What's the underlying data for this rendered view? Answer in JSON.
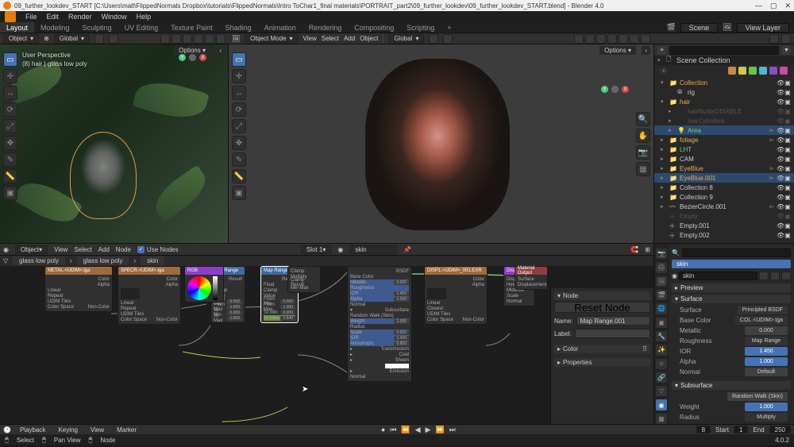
{
  "titlebar": {
    "text": "09_further_lookdev_START [C:\\Users\\malt\\FlippedNormals Dropbox\\tutorials\\FlippedNormals\\Intro ToChar1_final materials\\PORTRAIT_part2\\09_further_lookdev\\09_further_lookdev_START.blend] - Blender 4.0"
  },
  "menubar": {
    "items": [
      "File",
      "Edit",
      "Render",
      "Window",
      "Help"
    ]
  },
  "tabbar": {
    "tabs": [
      "Layout",
      "Modeling",
      "Sculpting",
      "UV Editing",
      "Texture Paint",
      "Shading",
      "Animation",
      "Rendering",
      "Compositing",
      "Scripting"
    ],
    "active": 0,
    "scene_label": "Scene",
    "viewlayer_label": "View Layer"
  },
  "hdr": {
    "object_menu": "Object",
    "global": "Global",
    "mode": "Object Mode",
    "menus": [
      "View",
      "Select",
      "Add",
      "Object"
    ],
    "options": "Options"
  },
  "vp1": {
    "line1": "User Perspective",
    "line2": "(8) hair | glass low poly"
  },
  "outliner": {
    "collection": "Scene Collection",
    "items": [
      {
        "depth": 0,
        "tri": "▾",
        "ic": "📁",
        "name": "Collection",
        "color": "#e8a854"
      },
      {
        "depth": 1,
        "tri": "",
        "ic": "⦾",
        "name": "rig",
        "color": "#ccc",
        "extras": true
      },
      {
        "depth": 0,
        "tri": "▾",
        "ic": "📁",
        "name": "hair",
        "color": "#e8a854"
      },
      {
        "depth": 1,
        "tri": "▸",
        "ic": "",
        "name": "hairNurbsDISABLE",
        "color": "#555",
        "disabled": true
      },
      {
        "depth": 1,
        "tri": "▸",
        "ic": "",
        "name": "hairCylinders",
        "color": "#555",
        "disabled": true
      },
      {
        "depth": 1,
        "tri": "▸",
        "ic": "💡",
        "name": "Area",
        "color": "#7aca7a",
        "sel": true,
        "arrow": true
      },
      {
        "depth": 0,
        "tri": "▸",
        "ic": "📁",
        "name": "foliage",
        "color": "#e8a854",
        "arrow": true
      },
      {
        "depth": 0,
        "tri": "▸",
        "ic": "📁",
        "name": "LHT",
        "color": "#7aca7a"
      },
      {
        "depth": 0,
        "tri": "▸",
        "ic": "📁",
        "name": "CAM",
        "color": "#ccc"
      },
      {
        "depth": 0,
        "tri": "▸",
        "ic": "📁",
        "name": "EyeBlue",
        "color": "#e8a854",
        "arrow": true
      },
      {
        "depth": 0,
        "tri": "▸",
        "ic": "📁",
        "name": "EyeBlue.001",
        "color": "#e8a854",
        "arrow": true,
        "sel": true
      },
      {
        "depth": 0,
        "tri": "▸",
        "ic": "📁",
        "name": "Collection 8",
        "color": "#ccc"
      },
      {
        "depth": 0,
        "tri": "▸",
        "ic": "📁",
        "name": "Collection 9",
        "color": "#ccc"
      },
      {
        "depth": 0,
        "tri": "▸",
        "ic": "〰",
        "name": "BezierCircle.001",
        "color": "#ccc",
        "arrow": true
      },
      {
        "depth": 0,
        "tri": "",
        "ic": "⊹",
        "name": "Empty",
        "color": "#555",
        "disabled": true
      },
      {
        "depth": 0,
        "tri": "",
        "ic": "⊹",
        "name": "Empty.001",
        "color": "#ccc"
      },
      {
        "depth": 0,
        "tri": "",
        "ic": "⊹",
        "name": "Empty.002",
        "color": "#ccc"
      }
    ]
  },
  "nodehdr": {
    "type": "Object",
    "menus": [
      "View",
      "Select",
      "Add",
      "Node"
    ],
    "use_nodes": "Use Nodes",
    "slot": "Slot 1",
    "mat": "skin"
  },
  "nodecrumb": {
    "a": "glass low poly",
    "b": "glass low poly",
    "c": "skin"
  },
  "nodes": {
    "metal": "METAL.<UDIM>.tga",
    "spec": "SPECR.<UDIM>.tga",
    "rgb": "RGB",
    "maprange": "Map Range",
    "maprange2": "Map Range.001",
    "bsdf": "Principled BSDF",
    "disp": "DISP1.<UDIM>_001.EXR",
    "displace": "Displacement",
    "out": "Material Output",
    "linear": "Linear",
    "closest": "Closest",
    "colorspace": "Color Space",
    "noncolor": "Non-Color",
    "udim": "UDIM Tiles",
    "result": "Result",
    "value": "Value",
    "frommin": "From Min",
    "frommax": "From Max",
    "tomin": "To Min",
    "tomax": "To Max",
    "basecolor": "Base Color",
    "metallic": "Metallic",
    "roughness": "Roughness",
    "ior": "IOR",
    "alpha": "Alpha",
    "normal": "Normal",
    "subsurface": "Subsurface",
    "weight": "Weight",
    "radius": "Radius",
    "scale": "Scale",
    "anisotropic": "Anisotropic",
    "transmission": "Transmission",
    "coat": "Coat",
    "sheen": "Sheen",
    "emission": "Emission",
    "v0": "0.000",
    "v1": "1.000",
    "v145": "1.450",
    "v154": "1.540",
    "vcolor": "Color",
    "surface": "Surface",
    "bsdf_out": "BSDF",
    "height": "Height",
    "midlevel": "Midlevel",
    "dispout": "Displacement",
    "randomwalk": "Random Walk (Skin)",
    "float": "Float",
    "clamp": "Clamp",
    "repeat": "Repeat",
    "clampresult": "Clamp Result",
    "minmax": "Min Max",
    "multiply": "Multiply"
  },
  "sidepanel": {
    "node": "Node",
    "reset": "Reset Node",
    "name_lbl": "Name:",
    "name_val": "Map Range.001",
    "label_lbl": "Label:",
    "label_val": "",
    "color": "Color",
    "properties": "Properties"
  },
  "props": {
    "mat": "skin",
    "preview": "Preview",
    "surface": "Surface",
    "surface_lbl": "Surface",
    "surface_val": "Principled BSDF",
    "basecolor_lbl": "Base Color",
    "basecolor_val": "COL.<UDIM>.tga",
    "metallic_lbl": "Metallic",
    "metallic_val": "0.000",
    "roughness_lbl": "Roughness",
    "roughness_val": "Map Range",
    "ior_lbl": "IOR",
    "ior_val": "1.450",
    "alpha_lbl": "Alpha",
    "alpha_val": "1.000",
    "normal_lbl": "Normal",
    "normal_val": "Default",
    "subsurface": "Subsurface",
    "sss_type": "Random Walk (Skin)",
    "weight_lbl": "Weight",
    "weight_val": "1.000",
    "radius_lbl": "Radius",
    "radius_val": "Multiply"
  },
  "timeline": {
    "playback": "Playback",
    "keying": "Keying",
    "view": "View",
    "marker": "Marker",
    "frame": "8",
    "start_lbl": "Start",
    "start": "1",
    "end_lbl": "End",
    "end": "250"
  },
  "status": {
    "select": "Select",
    "pan": "Pan View",
    "box": "Node",
    "version": "4.0.2"
  }
}
